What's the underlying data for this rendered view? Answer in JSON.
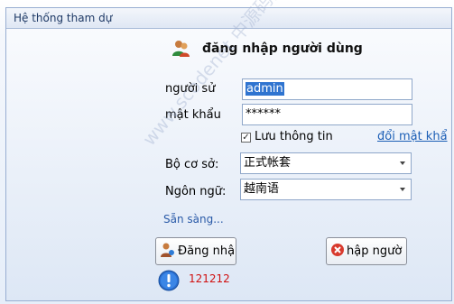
{
  "panel": {
    "title": "Hệ thống tham dự"
  },
  "login": {
    "title": "đăng nhập người dùng",
    "icon": "users-icon"
  },
  "form": {
    "username": {
      "label": "người sử",
      "value": "admin"
    },
    "password": {
      "label": "mật khẩu",
      "value": "******"
    },
    "remember": {
      "label": "Lưu thông tin",
      "checked": true
    },
    "change_password_link": "đổi mật khẩ",
    "account_set": {
      "label": "Bộ cơ sở:",
      "value": "正式帐套"
    },
    "language": {
      "label": "Ngôn ngữ:",
      "value": "越南语"
    }
  },
  "status_text": "Sẵn sàng...",
  "buttons": {
    "login": {
      "label": "Đăng nhập",
      "icon": "user-login-icon"
    },
    "exit": {
      "label": "hập ngườ",
      "icon": "close-circle-icon"
    }
  },
  "info": {
    "icon": "info-icon",
    "message": "121212"
  },
  "watermark": "www.scodenet 中源码网",
  "colors": {
    "accent": "#1c5fb6",
    "error": "#d01010",
    "selection": "#2f74d0"
  }
}
